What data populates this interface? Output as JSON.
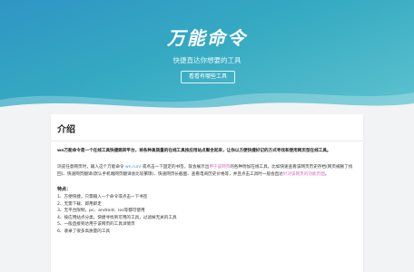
{
  "hero": {
    "title": "万能命令",
    "subtitle": "快捷直达你想要的工具",
    "button_label": "看看有哪些工具"
  },
  "intro": {
    "heading": "介绍",
    "bold_text": "wn万能命令是一个在线工具快捷跳转平台，将各种高质量的在线工具按应用站点聚合起来，让你以方便快捷好记的方式寻找和使用网页型在线工具。",
    "para_part1": "浏览任意网页时，输入这个万能命令 ",
    "para_link1": "wn.run/",
    "para_part2": " 或点击一下固定的书签，就会展示出",
    "para_link2": "用于该网页",
    "para_part3": "的各种附加在线工具，比如快速查看该网页历史存档(网页被删了找回)、快速网页翻译(默认手机端网页翻译会比较繁琐)、快速网页长截图、查看电商历史价格等，并且点击工具时一般会直达",
    "para_link3": "针对该网页的功能页面",
    "para_part4": "。"
  },
  "features": {
    "title": "特点：",
    "items": [
      "1、方便快捷，只需输入一个命令或点击一下书签",
      "2、无需下载、即用即走",
      "3、无平台限制，pc、android、ios等都可使用",
      "4、按应用站点分类，快捷寻找到可用的工具，过滤掉无关的工具",
      "5、一般直接到达用于该网页的工具详情页",
      "6、收录了很多高质量的工具"
    ]
  },
  "colors": {
    "hero_start": "#2f95c4",
    "hero_end": "#5fc3cf",
    "link_blue": "#3a8ee6",
    "link_pink": "#d86bc0"
  }
}
